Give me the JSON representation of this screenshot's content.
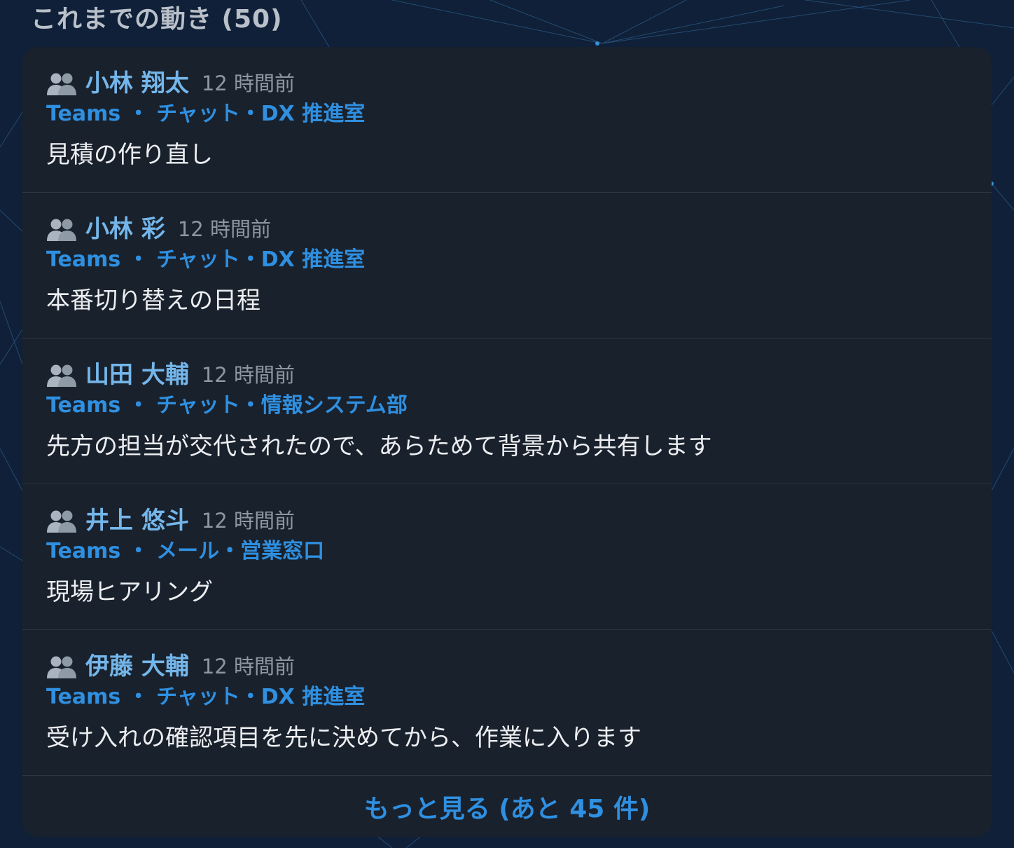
{
  "section": {
    "title": "これまでの動き (50)"
  },
  "activities": [
    {
      "name": "小林 翔太",
      "time": "12 時間前",
      "source": "Teams ・ チャット・DX 推進室",
      "message": "見積の作り直し"
    },
    {
      "name": "小林 彩",
      "time": "12 時間前",
      "source": "Teams ・ チャット・DX 推進室",
      "message": "本番切り替えの日程"
    },
    {
      "name": "山田 大輔",
      "time": "12 時間前",
      "source": "Teams ・ チャット・情報システム部",
      "message": "先方の担当が交代されたので、あらためて背景から共有します"
    },
    {
      "name": "井上 悠斗",
      "time": "12 時間前",
      "source": "Teams ・ メール・営業窓口",
      "message": "現場ヒアリング"
    },
    {
      "name": "伊藤 大輔",
      "time": "12 時間前",
      "source": "Teams ・ チャット・DX 推進室",
      "message": "受け入れの確認項目を先に決めてから、作業に入ります"
    }
  ],
  "more_button": {
    "label": "もっと見る (あと 45 件)"
  },
  "icons": {
    "person": "people-icon"
  },
  "colors": {
    "background": "#0f2038",
    "card": "#19212c",
    "name": "#74b6ea",
    "link": "#2f8fe0",
    "time": "#8e96a1",
    "message": "#eceef1"
  }
}
